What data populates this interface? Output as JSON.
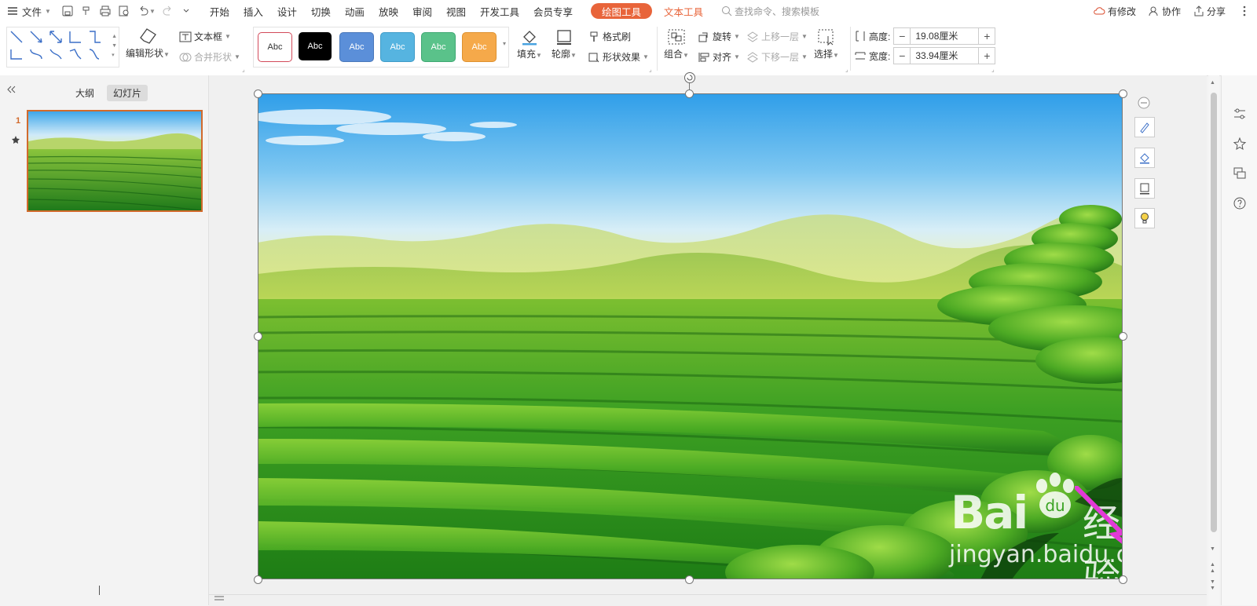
{
  "menubar": {
    "file": "文件",
    "tabs": [
      "开始",
      "插入",
      "设计",
      "切换",
      "动画",
      "放映",
      "审阅",
      "视图",
      "开发工具",
      "会员专享"
    ],
    "context_tab_draw": "绘图工具",
    "context_tab_text": "文本工具",
    "search_placeholder": "查找命令、搜索模板",
    "modified": "有修改",
    "collaborate": "协作",
    "share": "分享"
  },
  "ribbon": {
    "edit_shape": "编辑形状",
    "text_box": "文本框",
    "merge_shape": "合并形状",
    "style_sample": "Abc",
    "fill": "填充",
    "outline": "轮廓",
    "format_painter": "格式刷",
    "shape_effect": "形状效果",
    "group": "组合",
    "rotate": "旋转",
    "align": "对齐",
    "bring_forward": "上移一层",
    "send_backward": "下移一层",
    "select": "选择",
    "height_label": "高度:",
    "height_value": "19.08厘米",
    "width_label": "宽度:",
    "width_value": "33.94厘米",
    "minus": "−",
    "plus": "+"
  },
  "left_panel": {
    "tab_outline": "大纲",
    "tab_slides": "幻灯片",
    "slide_number": "1"
  },
  "watermark": {
    "brand": "Bai",
    "brand2": "经验",
    "url": "jingyan.baidu.com"
  },
  "colors": {
    "accent": "#e8643a",
    "style_colors": [
      "#ffffff",
      "#000000",
      "#5b8fd9",
      "#56b4e0",
      "#5ac28a",
      "#f5a94a"
    ]
  }
}
